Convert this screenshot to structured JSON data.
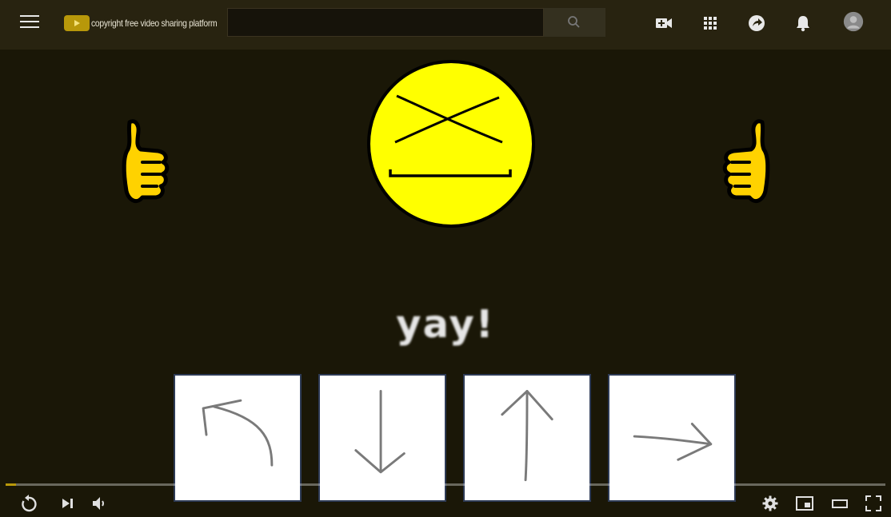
{
  "header": {
    "logo_text": "copyright free video sharing platform",
    "search_placeholder": "",
    "icons": [
      "menu-icon",
      "search-icon",
      "create-video-icon",
      "apps-grid-icon",
      "share-icon",
      "notifications-bell-icon",
      "account-avatar-icon"
    ]
  },
  "video": {
    "caption": "yay!",
    "choices": [
      {
        "name": "up-left-arrow",
        "icon": "arrow-up-left-icon"
      },
      {
        "name": "down-arrow",
        "icon": "arrow-down-icon"
      },
      {
        "name": "up-arrow",
        "icon": "arrow-up-icon"
      },
      {
        "name": "right-arrow",
        "icon": "arrow-right-icon"
      }
    ],
    "colors": {
      "face": "#ffff00",
      "thumb": "#ffd200",
      "background": "#1a1707",
      "progress": "#b8980a"
    }
  },
  "player": {
    "progress_fraction": 0.012,
    "controls_left": [
      "replay-icon",
      "next-icon",
      "volume-icon"
    ],
    "controls_right": [
      "settings-gear-icon",
      "miniplayer-icon",
      "theater-mode-icon",
      "fullscreen-icon"
    ]
  }
}
